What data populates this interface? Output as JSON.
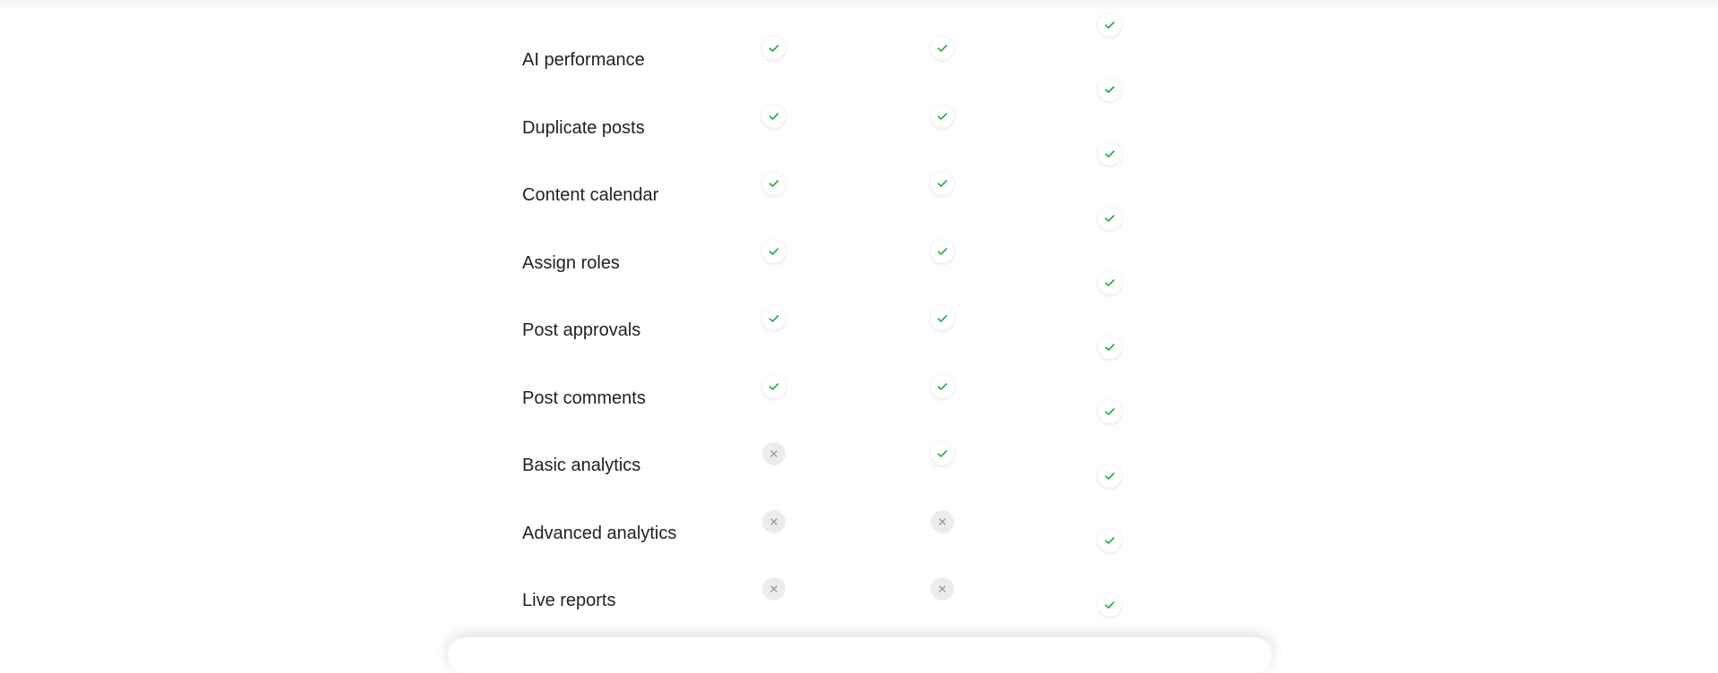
{
  "colors": {
    "check": "#22b04a",
    "cross": "#9a9a9a"
  },
  "features": [
    {
      "label": "AI performance",
      "plan_1": true,
      "plan_2": true,
      "plan_3": true
    },
    {
      "label": "Duplicate posts",
      "plan_1": true,
      "plan_2": true,
      "plan_3": true
    },
    {
      "label": "Content calendar",
      "plan_1": true,
      "plan_2": true,
      "plan_3": true
    },
    {
      "label": "Assign roles",
      "plan_1": true,
      "plan_2": true,
      "plan_3": true
    },
    {
      "label": "Post approvals",
      "plan_1": true,
      "plan_2": true,
      "plan_3": true
    },
    {
      "label": "Post comments",
      "plan_1": true,
      "plan_2": true,
      "plan_3": true
    },
    {
      "label": "Basic analytics",
      "plan_1": false,
      "plan_2": true,
      "plan_3": true
    },
    {
      "label": "Advanced analytics",
      "plan_1": false,
      "plan_2": false,
      "plan_3": true
    },
    {
      "label": "Live reports",
      "plan_1": false,
      "plan_2": false,
      "plan_3": true
    }
  ],
  "icons": {
    "yes": "check-icon",
    "no": "cross-icon"
  }
}
